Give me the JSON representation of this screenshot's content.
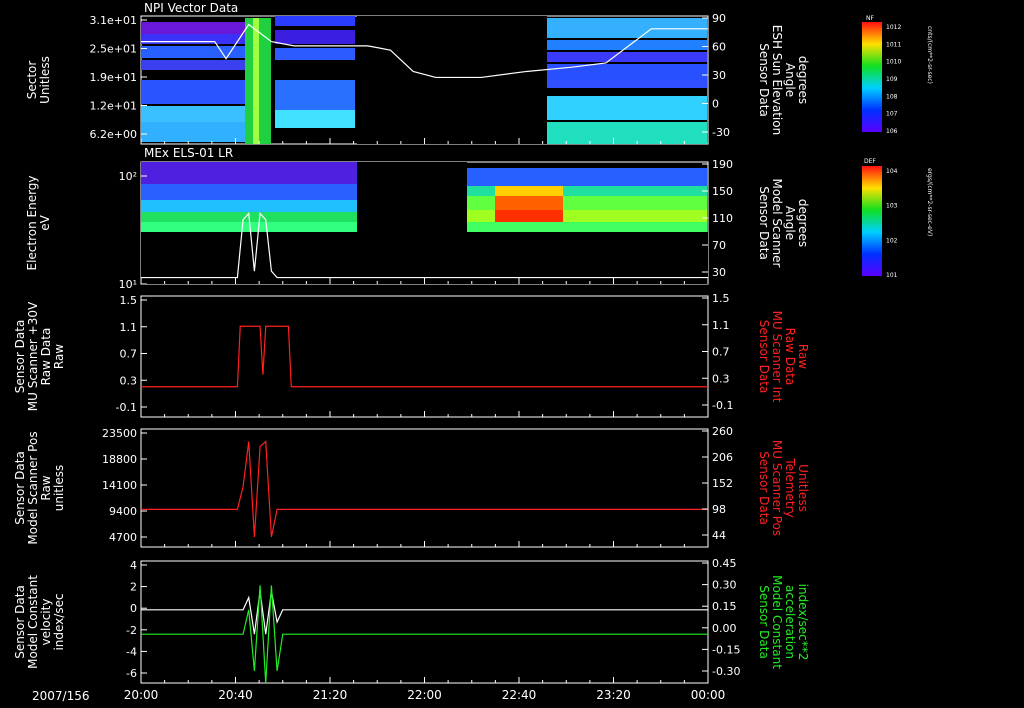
{
  "date_label": "2007/156",
  "time_ticks": [
    "20:00",
    "20:40",
    "21:20",
    "22:00",
    "22:40",
    "23:20",
    "00:00"
  ],
  "colors": {
    "axis": "#ffffff",
    "red": "#ff2020",
    "green": "#22ee22"
  },
  "colorbars": [
    {
      "tag": "NF",
      "exponents": [
        "12",
        "11",
        "10",
        "9",
        "8",
        "7",
        "6"
      ],
      "units": "cnts/(cm**2-sr-sec)"
    },
    {
      "tag": "DEF",
      "exponents": [
        "4",
        "3",
        "2",
        "1"
      ],
      "units": "ergs/(cm**2-sr-sec-eV)"
    }
  ],
  "chart_data": [
    {
      "type": "heatmap",
      "title": "NPI Vector Data",
      "ylabel_left": [
        "Sector",
        "Unitless"
      ],
      "ylabel_right": [
        "Sensor Data",
        "ESH Sun Elevation",
        "Angle",
        "degrees"
      ],
      "left_ticks": [
        "3.1e+01",
        "2.5e+01",
        "1.9e+01",
        "1.2e+01",
        "6.2e+00"
      ],
      "right_ticks": [
        "90",
        "60",
        "30",
        "0",
        "-30"
      ],
      "right_range": [
        -60,
        90
      ],
      "overlay_line": {
        "x": [
          0,
          0.13,
          0.15,
          0.16,
          0.19,
          0.23,
          0.27,
          0.4,
          0.44,
          0.48,
          0.52,
          0.6,
          0.68,
          0.76,
          0.82,
          0.86,
          0.9,
          1.0
        ],
        "y": [
          60,
          60,
          40,
          50,
          80,
          60,
          55,
          55,
          50,
          25,
          18,
          18,
          25,
          30,
          35,
          55,
          75,
          75
        ]
      },
      "bins": [
        {
          "x": [
            0.0,
            0.13
          ],
          "rows": "all",
          "level": "purple"
        },
        {
          "x": [
            0.13,
            0.16
          ],
          "rows": "all",
          "level": "green"
        },
        {
          "x": [
            0.16,
            0.27
          ],
          "rows": "all",
          "level": "blue"
        },
        {
          "x": [
            0.72,
            0.8
          ],
          "rows": "all",
          "level": "blue"
        },
        {
          "x": [
            0.8,
            1.0
          ],
          "rows": "all",
          "level": "blue"
        }
      ]
    },
    {
      "type": "heatmap",
      "title": "MEx ELS-01 LR",
      "ylabel_left": [
        "Electron Energy",
        "eV"
      ],
      "ylabel_right": [
        "Sensor Data",
        "Model Scanner",
        "Angle",
        "degrees"
      ],
      "left_ticks": [
        "10²",
        "10¹"
      ],
      "right_ticks": [
        "190",
        "150",
        "110",
        "70",
        "30"
      ],
      "right_range": [
        0,
        190
      ],
      "overlay_line": {
        "x": [
          0,
          0.17,
          0.18,
          0.19,
          0.2,
          0.21,
          0.22,
          0.23,
          0.24,
          0.25,
          1.0
        ],
        "y": [
          10,
          10,
          100,
          110,
          20,
          110,
          100,
          20,
          10,
          10,
          10
        ]
      }
    },
    {
      "type": "line",
      "ylabel_left": [
        "Sensor Data",
        "MU Scanner +30V",
        "Raw Data",
        "Raw"
      ],
      "ylabel_right": [
        "Sensor Data",
        "MU Scanner Int",
        "Raw Data",
        "Raw"
      ],
      "left_ticks": [
        "1.5",
        "1.1",
        "0.7",
        "0.3",
        "-0.1"
      ],
      "right_ticks": [
        "1.5",
        "1.1",
        "0.7",
        "0.3",
        "-0.1"
      ],
      "ylim": [
        -0.5,
        1.5
      ],
      "series": [
        {
          "x": [
            0,
            0.17,
            0.175,
            0.21,
            0.215,
            0.22,
            0.225,
            0.26,
            0.265,
            1.0
          ],
          "y": [
            0,
            0,
            1,
            1,
            0.2,
            1,
            1,
            1,
            0,
            0
          ]
        }
      ]
    },
    {
      "type": "line",
      "ylabel_left": [
        "Sensor Data",
        "Model Scanner Pos",
        "Raw",
        "unitless"
      ],
      "ylabel_right": [
        "Sensor Data",
        "MU Scanner Pos",
        "Telemetry",
        "Unitless"
      ],
      "left_ticks": [
        "23500",
        "18800",
        "14100",
        "9400",
        "4700"
      ],
      "right_ticks": [
        "260",
        "206",
        "152",
        "98",
        "44"
      ],
      "ylim": [
        0,
        23500
      ],
      "series": [
        {
          "x": [
            0,
            0.17,
            0.18,
            0.19,
            0.2,
            0.21,
            0.22,
            0.23,
            0.24,
            0.25,
            1.0
          ],
          "y": [
            7500,
            7500,
            12000,
            21000,
            2000,
            20000,
            21000,
            2000,
            7500,
            7500,
            7500
          ]
        }
      ]
    },
    {
      "type": "line",
      "ylabel_left": [
        "Sensor Data",
        "Model Constant",
        "velocity",
        "index/sec"
      ],
      "ylabel_right": [
        "Sensor Data",
        "Model Constant",
        "acceleration",
        "index/sec**2"
      ],
      "left_ticks": [
        "4",
        "2",
        "0",
        "-2",
        "-4",
        "-6"
      ],
      "right_ticks": [
        "0.45",
        "0.30",
        "0.15",
        "0.00",
        "-0.15",
        "-0.30"
      ],
      "ylim": [
        -6,
        4
      ],
      "series": [
        {
          "x": [
            0,
            0.18,
            0.19,
            0.2,
            0.21,
            0.22,
            0.23,
            0.24,
            0.25,
            1.0
          ],
          "y": [
            0,
            0,
            1,
            -2,
            1.5,
            -2,
            1.5,
            -1,
            0,
            0
          ]
        },
        {
          "x": [
            0,
            0.18,
            0.19,
            0.2,
            0.21,
            0.22,
            0.23,
            0.24,
            0.25,
            1.0
          ],
          "y": [
            -2,
            -2,
            0,
            -5,
            2,
            -6,
            2,
            -5,
            -2,
            -2
          ]
        }
      ]
    }
  ]
}
